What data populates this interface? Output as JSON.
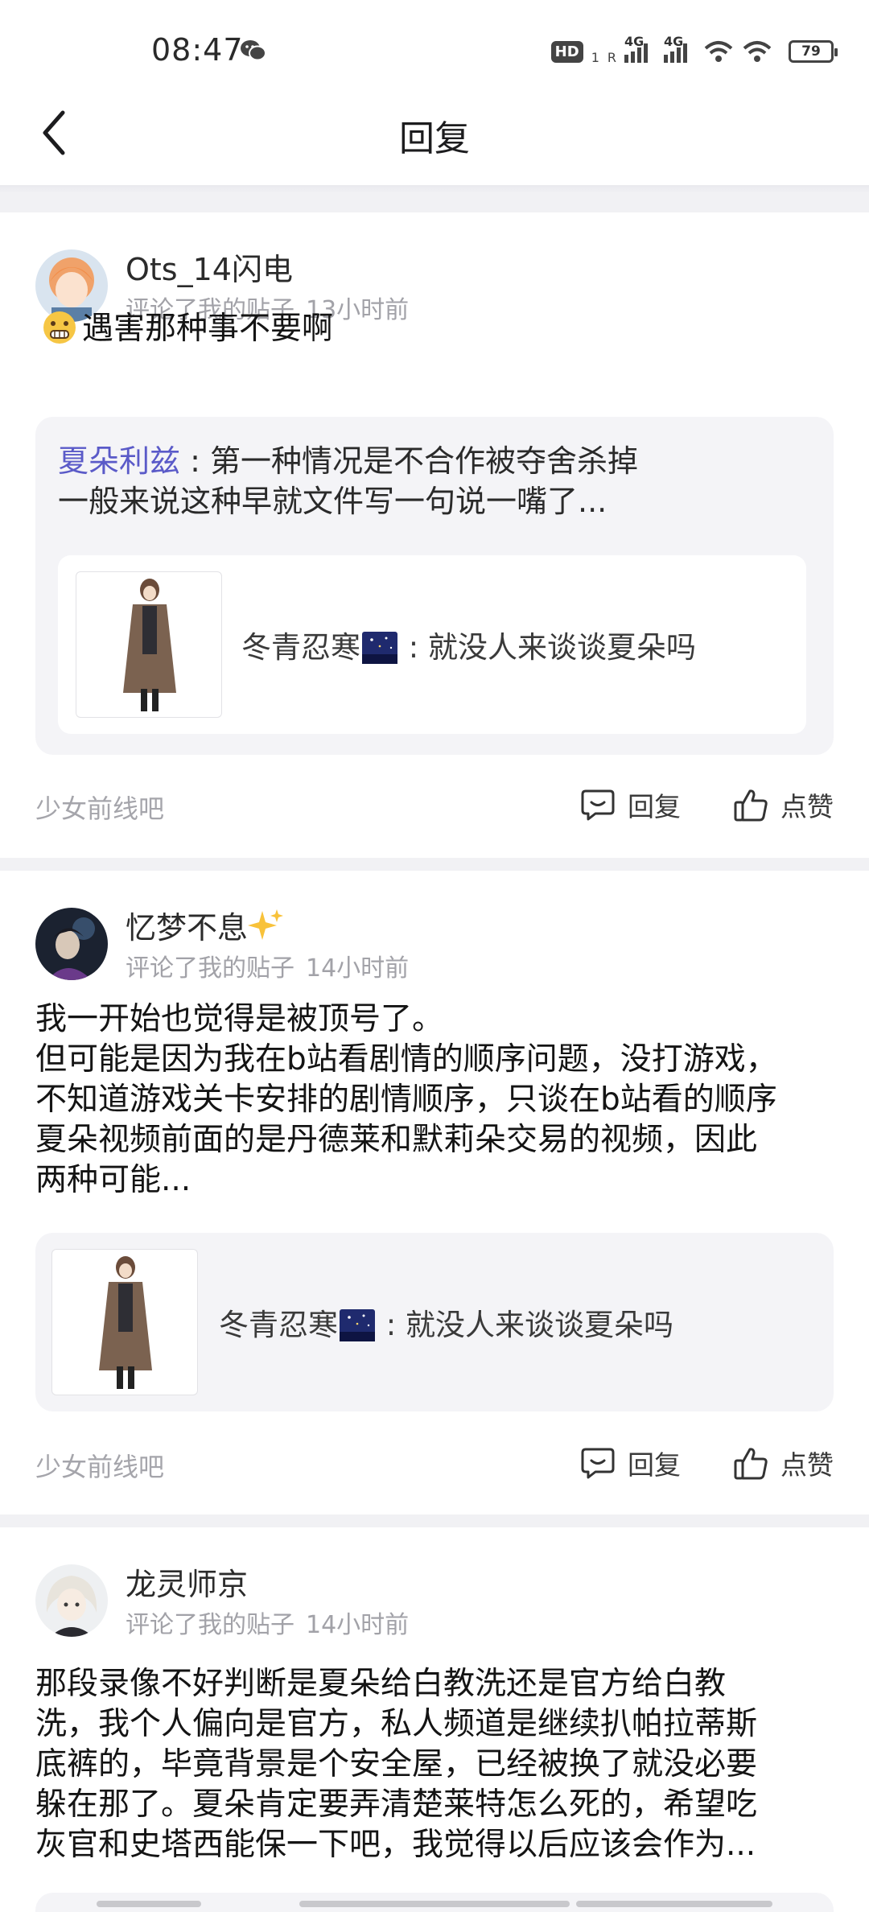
{
  "status_bar": {
    "time": "08:47",
    "hd_label": "HD",
    "sub_1": "1",
    "sub_r": "R",
    "net_1": "4G",
    "net_2": "4G",
    "battery": "79"
  },
  "nav": {
    "title": "回复"
  },
  "posts": [
    {
      "username": "Ots_14闪电",
      "action": "评论了我的贴子",
      "time": "13小时前",
      "content": "遇害那种事不要啊",
      "quote_author": "夏朵利兹",
      "quote_sep": " : ",
      "quote_line1": "第一种情况是不合作被夺舍杀掉",
      "quote_line2": "一般来说这种早就文件写一句说一嘴了...",
      "thread_author": "冬青忍寒",
      "thread_sep": " : ",
      "thread_title": "就没人来谈谈夏朵吗",
      "forum": "少女前线吧",
      "reply_label": "回复",
      "like_label": "点赞"
    },
    {
      "username": "忆梦不息",
      "action": "评论了我的贴子",
      "time": "14小时前",
      "content_lines": [
        "我一开始也觉得是被顶号了。",
        "但可能是因为我在b站看剧情的顺序问题，没打游戏，",
        "不知道游戏关卡安排的剧情顺序，只谈在b站看的顺序",
        "夏朵视频前面的是丹德莱和默莉朵交易的视频，因此",
        "两种可能..."
      ],
      "thread_author": "冬青忍寒",
      "thread_sep": " : ",
      "thread_title": "就没人来谈谈夏朵吗",
      "forum": "少女前线吧",
      "reply_label": "回复",
      "like_label": "点赞"
    },
    {
      "username": "龙灵师京",
      "action": "评论了我的贴子",
      "time": "14小时前",
      "content_lines": [
        "那段录像不好判断是夏朵给白教洗还是官方给白教",
        "洗，我个人偏向是官方，私人频道是继续扒帕拉蒂斯",
        "底裤的，毕竟背景是个安全屋，已经被换了就没必要",
        "躲在那了。夏朵肯定要弄清楚莱特怎么死的，希望吃",
        "灰官和史塔西能保一下吧，我觉得以后应该会作为..."
      ]
    }
  ],
  "colors": {
    "accent_name": "#5a5ac8",
    "meta_gray": "#a2a2a8",
    "page_bg": "#f1f1f4"
  }
}
